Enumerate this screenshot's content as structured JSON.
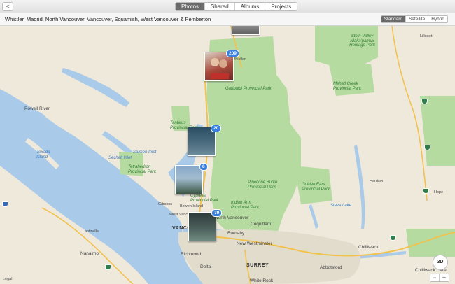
{
  "toolbar": {
    "back_label": "<",
    "tabs": [
      {
        "label": "Photos",
        "active": true
      },
      {
        "label": "Shared",
        "active": false
      },
      {
        "label": "Albums",
        "active": false
      },
      {
        "label": "Projects",
        "active": false
      }
    ]
  },
  "titlebar": {
    "title": "Whistler, Madrid, North Vancouver, Vancouver, Squamish, West Vancouver & Pemberton",
    "map_modes": [
      {
        "label": "Standard",
        "active": true
      },
      {
        "label": "Satellite",
        "active": false
      },
      {
        "label": "Hybrid",
        "active": false
      }
    ]
  },
  "map": {
    "labels": {
      "garibaldi": "Garibaldi Provincial Park",
      "garibaldi_small": "Garibaldi Provincial Park",
      "stein": "Stein Valley Nlaka'pamux Heritage Park",
      "mehatl": "Mehatl Creek Provincial Park",
      "tantalus": "Tantalus Provincial Park",
      "tetrahedron": "Tetrahedron Provincial Park",
      "pinecone": "Pinecone Burke Provincial Park",
      "golden_ears": "Golden Ears Provincial Park",
      "indian_arm": "Indian Arm Provincial Park",
      "cypress": "Cypress Provincial Park",
      "powell_river": "Powell River",
      "texada": "Texada Island",
      "salmon_inlet": "Salmon Inlet",
      "sechelt": "Sechelt Inlet",
      "vancouver": "VANCOUVER",
      "north_vancouver": "North Vancouver",
      "west_vancouver": "West Vancouver",
      "burnaby": "Burnaby",
      "coquitlam": "Coquitlam",
      "new_westminster": "New Westminster",
      "richmond": "Richmond",
      "surrey": "SURREY",
      "delta": "Delta",
      "abbotsford": "Abbotsford",
      "chilliwack": "Chilliwack",
      "chilliwack_lake": "Chilliwack Lake",
      "white_rock": "White Rock",
      "nanaimo": "Nanaimo",
      "lantzville": "Lantzville",
      "gibsons": "Gibsons",
      "bowen": "Bowen Island",
      "harrison": "Harrison",
      "stave": "Stave Lake",
      "whistler": "Whistler",
      "lillooet": "Lillooet",
      "hope": "Hope"
    },
    "legal": "Legal"
  },
  "clusters": [
    {
      "count": "209",
      "colors": [
        "#a84a3c",
        "#d9cfc1"
      ]
    },
    {
      "count": "20",
      "colors": [
        "#2b4d63",
        "#6e8c9b"
      ]
    },
    {
      "count": "6",
      "colors": [
        "#86a7c9",
        "#3c5745"
      ]
    },
    {
      "count": "79",
      "colors": [
        "#2c3a3a",
        "#6f8a80"
      ]
    }
  ],
  "controls": {
    "compass_label": "3D",
    "zoom_out": "−",
    "zoom_in": "+"
  }
}
